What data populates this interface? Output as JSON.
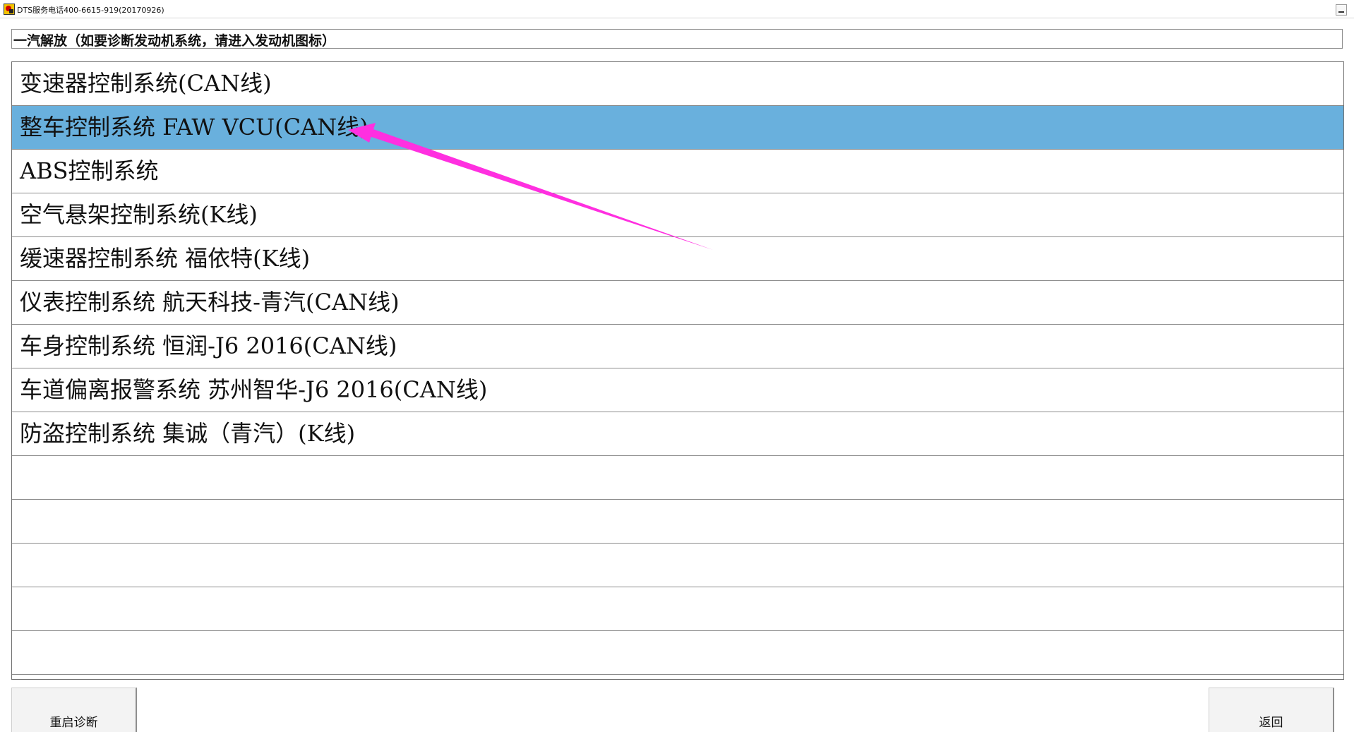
{
  "window": {
    "title": "DTS服务电话400-6615-919(20170926)",
    "icon": "app-logo-icon",
    "minimize_icon": "minimize-icon"
  },
  "header": {
    "text": "一汽解放（如要诊断发动机系统，请进入发动机图标）"
  },
  "list": {
    "selected_index": 1,
    "selected_color": "#69b0dd",
    "items": [
      {
        "label": "变速器控制系统(CAN线)"
      },
      {
        "label": "整车控制系统 FAW VCU(CAN线)"
      },
      {
        "label": "ABS控制系统"
      },
      {
        "label": "空气悬架控制系统(K线)"
      },
      {
        "label": "缓速器控制系统 福依特(K线)"
      },
      {
        "label": "仪表控制系统 航天科技-青汽(CAN线)"
      },
      {
        "label": "车身控制系统 恒润-J6 2016(CAN线)"
      },
      {
        "label": "车道偏离报警系统 苏州智华-J6 2016(CAN线)"
      },
      {
        "label": "防盗控制系统 集诚（青汽）(K线)"
      },
      {
        "label": ""
      },
      {
        "label": ""
      },
      {
        "label": ""
      },
      {
        "label": ""
      },
      {
        "label": ""
      }
    ]
  },
  "buttons": {
    "restart_label": "重启诊断",
    "back_label": "返回"
  },
  "annotation": {
    "arrow_color": "#ff2fe0"
  }
}
